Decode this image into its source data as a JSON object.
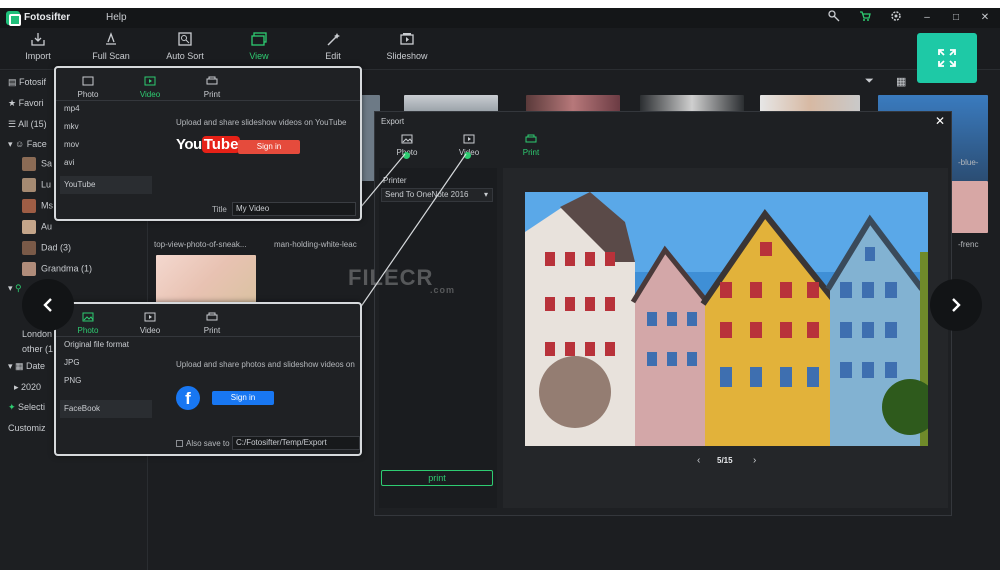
{
  "app": {
    "name": "Fotosifter",
    "menu_help": "Help"
  },
  "toolbar": [
    {
      "label": "Import",
      "icon": "import-icon"
    },
    {
      "label": "Full Scan",
      "icon": "full-scan-icon"
    },
    {
      "label": "Auto Sort",
      "icon": "auto-sort-icon"
    },
    {
      "label": "View",
      "icon": "view-icon",
      "active": true
    },
    {
      "label": "Edit",
      "icon": "edit-icon"
    },
    {
      "label": "Slideshow",
      "icon": "slideshow-icon"
    }
  ],
  "sidebar": {
    "fotosifter": "Fotosif",
    "favorites": "Favori",
    "all": "All (15)",
    "face": "Face",
    "faces": [
      "Sa",
      "Lu",
      "Ms",
      "Au"
    ],
    "dad": "Dad (3)",
    "grandma": "Grandma (1)",
    "london": "London",
    "other": "other (1",
    "date": "Date",
    "year": "2020",
    "selection": "Selecti",
    "customize": "Customiz"
  },
  "grid": {
    "captions": [
      "top-view-photo-of-sneak...",
      "man-holding-white-leac",
      "-blue-",
      "-frenc"
    ]
  },
  "video_popup": {
    "tabs": [
      "Photo",
      "Video",
      "Print"
    ],
    "formats": [
      "mp4",
      "mkv",
      "mov",
      "avi"
    ],
    "selected": "YouTube",
    "description": "Upload and share slideshow videos on YouTube",
    "brand": "YouTube",
    "signin": "Sign in",
    "title_label": "Title",
    "title_value": "My Video"
  },
  "photo_popup": {
    "tabs": [
      "Photo",
      "Video",
      "Print"
    ],
    "formats": [
      "Original file format",
      "JPG",
      "PNG"
    ],
    "selected": "FaceBook",
    "description": "Upload and share photos and slideshow videos on",
    "signin": "Sign in",
    "also_save_label": "Also save to",
    "path": "C:/Fotosifter/Temp/Export"
  },
  "export": {
    "title": "Export",
    "tabs": [
      "Photo",
      "Video",
      "Print"
    ],
    "printer_label": "Printer",
    "printer_value": "Send To OneNote 2016",
    "print_button": "print",
    "page": "5/15"
  },
  "watermark": {
    "text": "FILECR",
    "sub": ".com"
  },
  "colors": {
    "accent": "#2ecc71",
    "expand": "#1ec9a6",
    "youtube": "#e62117",
    "facebook": "#1877f2"
  }
}
